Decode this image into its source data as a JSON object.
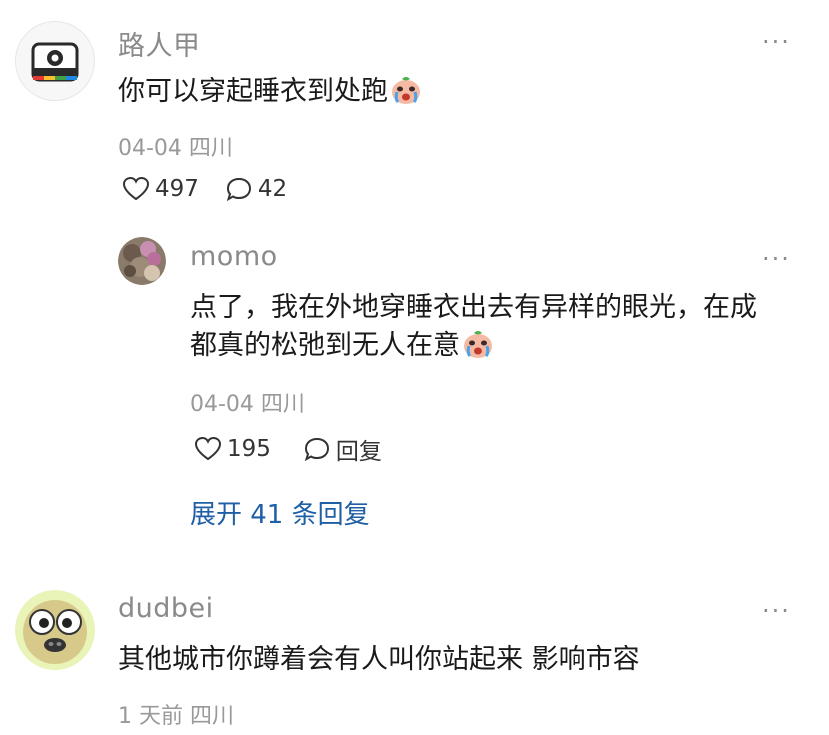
{
  "comments": [
    {
      "username": "路人甲",
      "text": "你可以穿起睡衣到处跑",
      "emoji": "crying-face-emoji",
      "meta": "04-04 四川",
      "likes": "497",
      "replies_count": "42",
      "more": "···",
      "reply": {
        "username": "momo",
        "text_line1": "点了，我在外地穿睡衣出去有异样的眼光，在成",
        "text_line2": "都真的松弛到无人在意",
        "emoji": "crying-face-emoji",
        "meta": "04-04 四川",
        "likes": "195",
        "reply_label": "回复",
        "more": "···"
      },
      "expand_label": "展开 41 条回复"
    },
    {
      "username": "dudbei",
      "text": "其他城市你蹲着会有人叫你站起来 影响市容",
      "meta": "1 天前 四川",
      "more": "···"
    }
  ],
  "colors": {
    "link": "#1f5fa6",
    "muted": "#8a8a8a",
    "text": "#1a1a1a"
  }
}
